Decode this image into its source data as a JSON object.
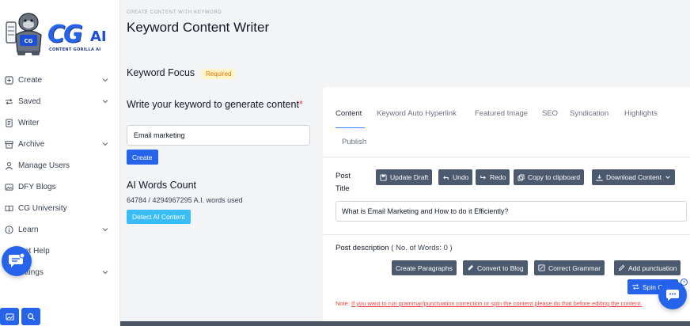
{
  "logo": {
    "brand": "CG",
    "brand_suffix": "AI",
    "tagline": "CONTENT GORILLA AI"
  },
  "sidebar": {
    "items": [
      {
        "label": "Create",
        "icon": "plus-square-icon",
        "has_chevron": true
      },
      {
        "label": "Saved",
        "icon": "repeat-icon",
        "has_chevron": true
      },
      {
        "label": "Writer",
        "icon": "document-icon",
        "has_chevron": false
      },
      {
        "label": "Archive",
        "icon": "archive-icon",
        "has_chevron": true
      },
      {
        "label": "Manage Users",
        "icon": "user-icon",
        "has_chevron": false
      },
      {
        "label": "DFY Blogs",
        "icon": "image-icon",
        "has_chevron": false
      },
      {
        "label": "CG University",
        "icon": "book-icon",
        "has_chevron": false
      },
      {
        "label": "Learn",
        "icon": "info-icon",
        "has_chevron": true
      },
      {
        "label": "et Help",
        "icon": "help-icon",
        "has_chevron": false
      },
      {
        "label": "ttings",
        "icon": "settings-icon",
        "has_chevron": true
      }
    ]
  },
  "header": {
    "breadcrumb": "CREATE CONTENT WITH KEYWORD",
    "title": "Keyword Content Writer"
  },
  "keyword_focus": {
    "title": "Keyword Focus",
    "required_badge": "Required",
    "label": "Write your keyword to generate content",
    "required_mark": "*",
    "input_value": "Email marketing",
    "create_label": "Create"
  },
  "ai_words": {
    "title": "AI Words Count",
    "count_text": "64784 / 4294967295 A.I. words used",
    "detect_label": "Detect AI Content"
  },
  "tabs": [
    {
      "label": "Content",
      "active": true
    },
    {
      "label": "Keyword Auto Hyperlink",
      "active": false
    },
    {
      "label": "Featured Image",
      "active": false
    },
    {
      "label": "SEO",
      "active": false
    },
    {
      "label": "Syndication",
      "active": false
    },
    {
      "label": "Highlights",
      "active": false
    },
    {
      "label": "Publish",
      "active": false
    }
  ],
  "post_title": {
    "label": "Post Title",
    "value": "What is Email Marketing and How to do it Efficiently?",
    "buttons": {
      "update_draft": "Update Draft",
      "undo": "Undo",
      "redo": "Redo",
      "copy": "Copy to clipboard",
      "download": "Download Content"
    }
  },
  "post_description": {
    "label": "Post description",
    "words_text": "( No. of Words: 0 )",
    "buttons": {
      "paragraphs": "Create Paragraphs",
      "blog": "Convert to Blog",
      "grammar": "Correct Grammar",
      "punctuation": "Add punctuation",
      "spin": "Spin C"
    },
    "note_prefix": "Note: ",
    "note_text": "If you want to run grammar/punctuation correction or spin the content please do that before editing the content."
  },
  "colors": {
    "primary": "#2563eb",
    "dark_button": "#4b5a6e",
    "accent_info": "#38bdf8",
    "warning": "#d97706",
    "danger": "#ef4444"
  }
}
